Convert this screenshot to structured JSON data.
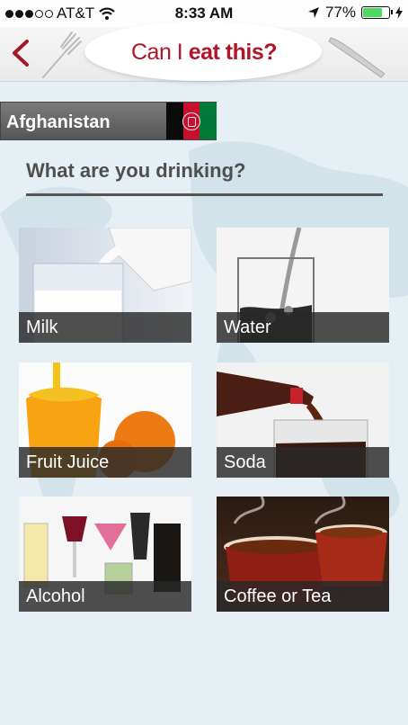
{
  "status_bar": {
    "carrier": "AT&T",
    "time": "8:33 AM",
    "battery_text": "77%",
    "battery_level": 0.77,
    "signal_dots_filled": 3,
    "signal_dots_total": 5
  },
  "header": {
    "title_light": "Can I ",
    "title_bold": "eat this?",
    "accent_color": "#b0152a"
  },
  "country": {
    "name": "Afghanistan",
    "flag_colors": [
      "#0b0b0b",
      "#c8102e",
      "#007a36"
    ]
  },
  "question": "What are you drinking?",
  "drinks": [
    {
      "label": "Milk"
    },
    {
      "label": "Water"
    },
    {
      "label": "Fruit Juice"
    },
    {
      "label": "Soda"
    },
    {
      "label": "Alcohol"
    },
    {
      "label": "Coffee or Tea"
    }
  ]
}
